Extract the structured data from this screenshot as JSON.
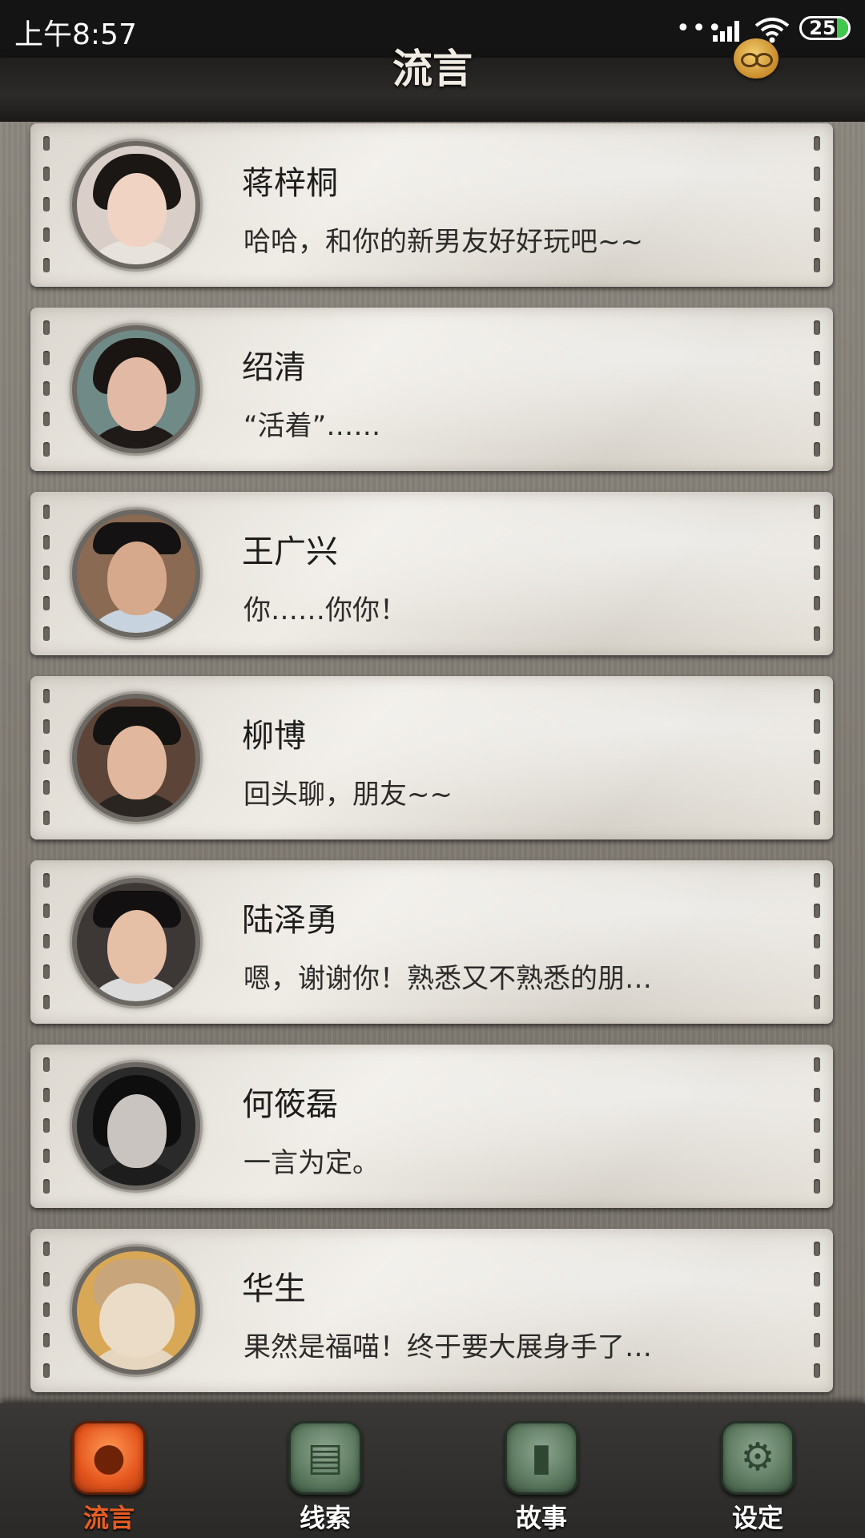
{
  "status_bar": {
    "time": "上午8:57",
    "dots": "•••",
    "battery_level": "25",
    "icons": [
      "signal-icon",
      "wifi-icon",
      "battery-icon"
    ]
  },
  "header": {
    "title": "流言",
    "mascot_icon": "mascot-badge-icon"
  },
  "contacts": [
    {
      "name": "蒋梓桐",
      "message": "哈哈，和你的新男友好好玩吧~~"
    },
    {
      "name": "绍清",
      "message": "“活着”……"
    },
    {
      "name": "王广兴",
      "message": "你……你你！"
    },
    {
      "name": "柳博",
      "message": "回头聊，朋友~~"
    },
    {
      "name": "陆泽勇",
      "message": "嗯，谢谢你！熟悉又不熟悉的朋…"
    },
    {
      "name": "何筱磊",
      "message": "一言为定。"
    },
    {
      "name": "华生",
      "message": "果然是福喵！终于要大展身手了…"
    }
  ],
  "bottom_nav": {
    "tabs": [
      {
        "label": "流言",
        "icon": "chat-bubble-icon",
        "active": true
      },
      {
        "label": "线索",
        "icon": "clue-paper-icon",
        "active": false
      },
      {
        "label": "故事",
        "icon": "book-icon",
        "active": false
      },
      {
        "label": "设定",
        "icon": "gear-icon",
        "active": false
      }
    ]
  },
  "colors": {
    "active_tab": "#e85d23",
    "inactive_tab": "#5d7a60",
    "battery_green": "#41c84b",
    "card_paper": "#e6e2da",
    "header_bg": "#2d2b29"
  }
}
